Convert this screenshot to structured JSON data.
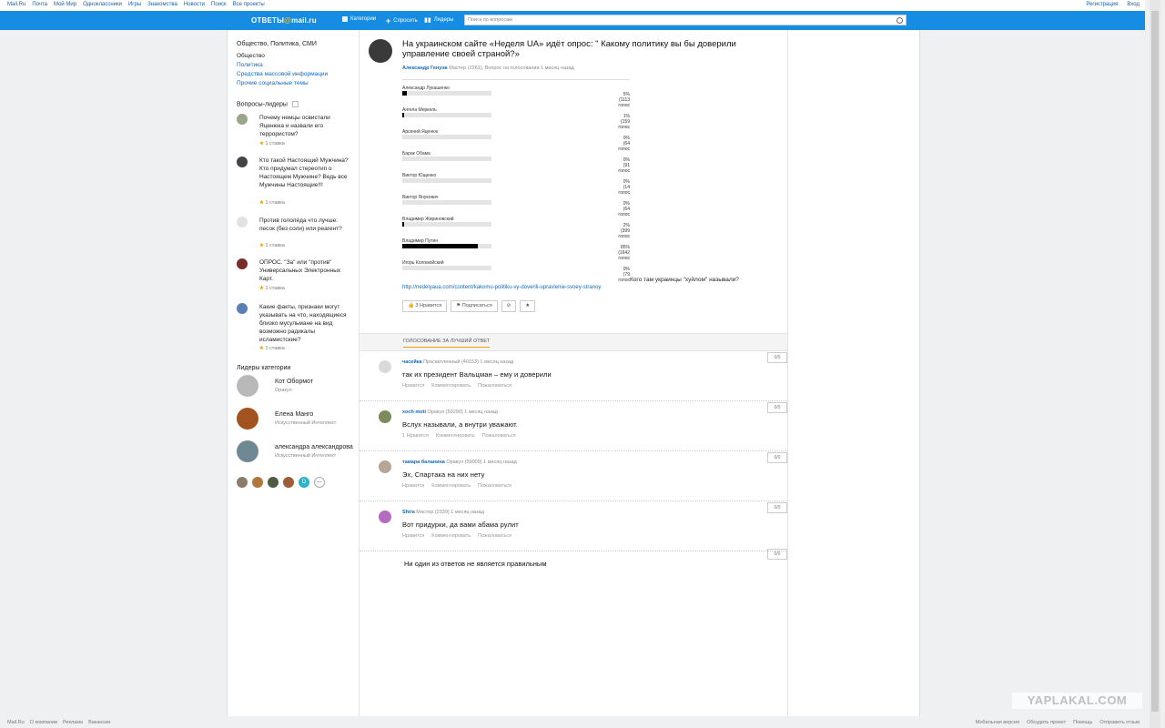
{
  "topbar": {
    "left": [
      "Mail.Ru",
      "Почта",
      "Мой Мир",
      "Одноклассники",
      "Игры",
      "Знакомства",
      "Новости",
      "Поиск",
      "Все проекты"
    ],
    "right": [
      "Регистрация",
      "Вход"
    ]
  },
  "header": {
    "logo_main": "ОТВЕТЫ",
    "logo_at": "@",
    "logo_domain": "mail.ru",
    "nav": [
      "Категории",
      "Спросить",
      "Лидеры"
    ],
    "search_placeholder": "Поиск по вопросам"
  },
  "sidebar": {
    "category_title": "Общество, Политика, СМИ",
    "categories": [
      "Общество",
      "Политика",
      "Средства массовой информации",
      "Прочие социальные темы"
    ],
    "leaders_title": "Вопросы-лидеры",
    "questions": [
      {
        "text": "Почему немцы освистали Яценюка и назвали его террористом?",
        "stars": "1 ставка"
      },
      {
        "text": "Кто такой Настоящий Мужчина? Кто придумал стереотип о Настоящем Мужчине? Ведь все Мужчины Настоящие!!!",
        "stars": "1 ставка"
      },
      {
        "text": "Против гололёда что лучше: песок (без соли) или реагент?",
        "stars": "1 ставка"
      },
      {
        "text": "ОПРОС. \"За\" или \"против\" Универсальных Электронных Карт.",
        "stars": "1 ставка"
      },
      {
        "text": "Какие факты, признаки могут указывать на что, находящиеся близко мусульмане на вид возможно радикалы исламистские?",
        "stars": "1 ставка"
      }
    ],
    "cat_leaders_title": "Лидеры категории",
    "leaders": [
      {
        "name": "Кот Обормот",
        "rank": "Оракул"
      },
      {
        "name": "Елена Манго",
        "rank": "Искусственный Интеллект"
      },
      {
        "name": "александра александрова",
        "rank": "Искусственный Интеллект"
      }
    ],
    "mini_d": "D",
    "mini_more": "—"
  },
  "question": {
    "title": "На украинском сайте «Неделя UA» идёт опрос: \" Какому политику вы бы доверили управление своей страной?»",
    "author": "Александр Генуэв",
    "meta": "Мастер (2261), Вопрос на голосовании 1 месяц назад",
    "after_poll": "Кого там украинцы \"хуйлом\" называли?",
    "link": "http://nedelyaua.com/content/kakomu-politiku-vy-doverili-upravlenie-svoey-stranoy",
    "like_btn": "3 Нравится",
    "subscribe_btn": "Подписаться",
    "block_btn": "⊘",
    "star_btn": "★"
  },
  "chart_data": {
    "type": "bar",
    "categories": [
      "Александр Лукашенко",
      "Ангела Меркель",
      "Арсений Яценюк",
      "Барак Обама",
      "Виктор Ющенко",
      "Виктор Янукович",
      "Владимир Жириновский",
      "Владимир Путин",
      "Игорь Коломойский"
    ],
    "values": [
      5,
      1,
      0,
      0,
      0,
      0,
      2,
      85,
      0
    ],
    "votes": [
      "(1113 голос",
      "(159 голос",
      "(64 голос",
      "(91 голос",
      "(14 голос",
      "(64 голос",
      "(399 голос",
      "(1642 голос",
      "(79 голос"
    ],
    "ylim": [
      0,
      100
    ]
  },
  "voting": {
    "tab": "ГОЛОСОВАНИЕ ЗА ЛУЧШИЙ ОТВЕТ"
  },
  "answers": [
    {
      "author": "часейка",
      "meta": "Просветленный (40153) 1 месяц назад",
      "text": "так их президент Вальцман – ему и доверили",
      "likes": "Нравится",
      "comment": "Комментировать",
      "report": "Пожаловаться",
      "count": "0/0"
    },
    {
      "author": "xoch moti",
      "meta": "Оракул (59290) 1 месяц назад",
      "text": "Вслух называли, а внутри уважают.",
      "likes": "1 Нравится",
      "comment": "Комментировать",
      "report": "Пожаловаться",
      "count": "0/0"
    },
    {
      "author": "тамара баланина",
      "meta": "Оракул (59009) 1 месяц назад",
      "text": "Эх, Спартака на них нету",
      "likes": "Нравится",
      "comment": "Комментировать",
      "report": "Пожаловаться",
      "count": "0/0"
    },
    {
      "author": "Shira",
      "meta": "Мастер (2339) 1 месяц назад",
      "text": "Вот придурки, да вами абама рулит",
      "likes": "Нравится",
      "comment": "Комментировать",
      "report": "Пожаловаться",
      "count": "0/0"
    }
  ],
  "no_best": {
    "text": "Ни один из ответов не является правильным",
    "count": "0/0"
  },
  "footer": {
    "left": [
      "Mail.Ru",
      "О компании",
      "Реклама",
      "Вакансии"
    ],
    "right": [
      "Мобильная версия",
      "Обсудить проект",
      "Помощь",
      "Отправить отзыв"
    ]
  },
  "watermark": "YAPLAKAL.COM"
}
